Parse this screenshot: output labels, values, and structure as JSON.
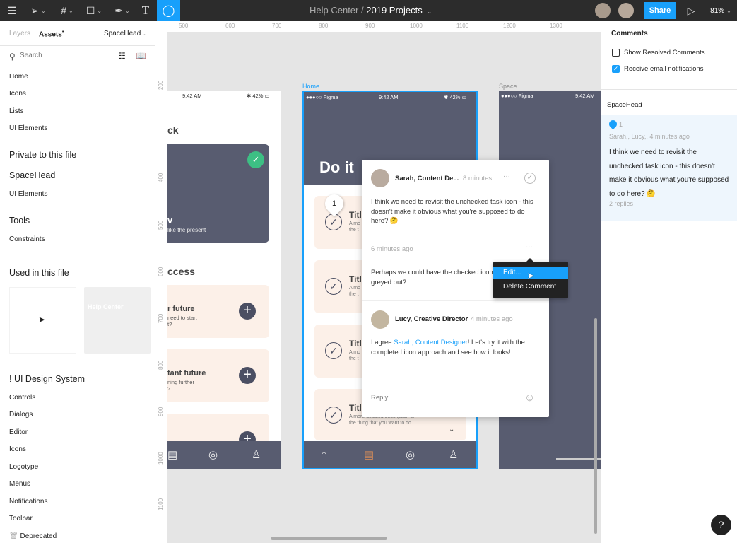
{
  "toolbar": {
    "title_project": "Help Center",
    "title_sep": "/",
    "title_file": "2019 Projects",
    "share_label": "Share",
    "zoom": "81%",
    "accent": "#18a0fb",
    "tools": [
      "menu-icon",
      "move-icon",
      "frame-icon",
      "rectangle-icon",
      "pen-icon",
      "text-icon",
      "comment-icon"
    ]
  },
  "left_panel": {
    "tabs": [
      "Layers",
      "Assets"
    ],
    "assets_dot": "•",
    "library": "SpaceHead",
    "search_placeholder": "Search",
    "items_top": [
      "Home",
      "Icons",
      "Lists",
      "UI Elements"
    ],
    "private_heading": "Private to this file",
    "spacehead_heading": "SpaceHead",
    "spacehead_items": [
      "UI Elements"
    ],
    "tools_heading": "Tools",
    "tools_items": [
      "Constraints"
    ],
    "used_heading": "Used in this file",
    "thumb_label": "Help Center",
    "ds_heading": "! UI Design System",
    "ds_items": [
      "Controls",
      "Dialogs",
      "Editor",
      "Icons",
      "Logotype",
      "Menus",
      "Notifications",
      "Toolbar"
    ],
    "deprecated": "Deprecated"
  },
  "rulers": {
    "top": [
      "500",
      "600",
      "700",
      "800",
      "900",
      "1000",
      "1100",
      "1200",
      "1300"
    ],
    "left": [
      "200",
      "300",
      "400",
      "500",
      "600",
      "700",
      "800",
      "900",
      "1000",
      "1100"
    ]
  },
  "frames": {
    "left": {
      "time": "9:42 AM",
      "battery": "42%",
      "heading1": "ck",
      "card_title": "v",
      "card_sub": "like the present",
      "heading2": "ccess",
      "cards": [
        {
          "title": "r future",
          "sub1": "need to start",
          "sub2": "t?"
        },
        {
          "title": "tant future",
          "sub1": "ning further",
          "sub2": "?"
        }
      ]
    },
    "home": {
      "label": "Home",
      "carrier": "●●●○○ Figma",
      "time": "9:42 AM",
      "battery": "42%",
      "heading": "Do it",
      "pin": "1",
      "items": [
        {
          "title": "Titl",
          "d1": "A mo",
          "d2": "the t"
        },
        {
          "title": "Titl",
          "d1": "A mo",
          "d2": "the t"
        },
        {
          "title": "Titl",
          "d1": "A mo",
          "d2": "the t"
        },
        {
          "title": "Titl",
          "d1": "A more detailed description of",
          "d2": "the thing that you want to do..."
        }
      ]
    },
    "space": {
      "label": "Space",
      "carrier": "●●●○○ Figma",
      "time": "9:42 AM"
    }
  },
  "comment_thread": {
    "first": {
      "author": "Sarah, Content De...",
      "time": "8 minutes...",
      "body": "I think we need to revisit the unchecked task icon - this doesn't make it obvious what you're supposed to do here? 🤔"
    },
    "second": {
      "time": "6 minutes ago",
      "body": "Perhaps we could have the checked icon greyed out?"
    },
    "third": {
      "author": "Lucy, Creative Director",
      "time": "4 minutes ago",
      "pre": "I agree ",
      "mention": "Sarah, Content Designer",
      "post": "! Let's try it with the completed icon approach and see how it looks!"
    },
    "reply_placeholder": "Reply"
  },
  "context_menu": {
    "items": [
      "Edit...",
      "Delete Comment"
    ]
  },
  "right_panel": {
    "heading": "Comments",
    "options": [
      {
        "label": "Show Resolved Comments",
        "checked": false
      },
      {
        "label": "Receive email notifications",
        "checked": true
      }
    ],
    "file": "SpaceHead",
    "thread": {
      "count": "1",
      "meta": "Sarah,, Lucy,, 4 minutes ago",
      "body": "I think we need to revisit the unchecked task icon - this doesn't make it obvious what you're supposed to do here? 🤔",
      "replies": "2 replies"
    }
  },
  "help_label": "?"
}
